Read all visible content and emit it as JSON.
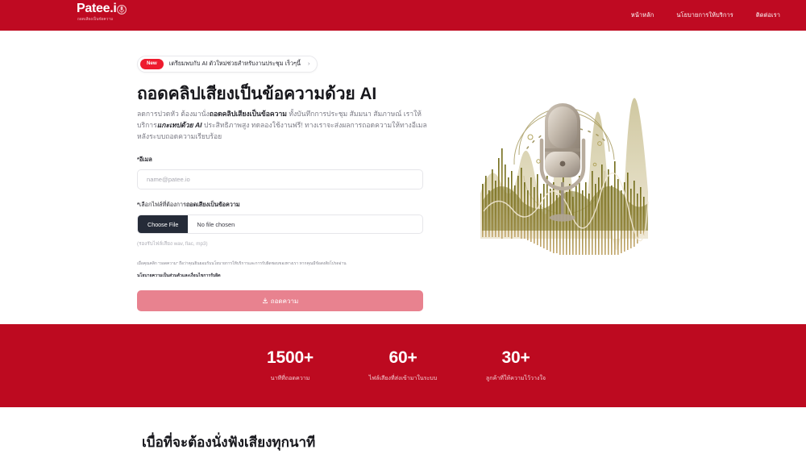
{
  "header": {
    "logo": {
      "text": "Patee.i",
      "mic_icon": "microphone-icon",
      "subtitle": "ถอดเสียงเป็นข้อความ"
    },
    "brand_color": "#bf0a22",
    "nav": [
      {
        "label": "หน้าหลัก",
        "name": "nav-home"
      },
      {
        "label": "นโยบายการให้บริการ",
        "name": "nav-service-policy"
      },
      {
        "label": "ติดต่อเรา",
        "name": "nav-contact"
      }
    ]
  },
  "hero": {
    "pill": {
      "badge": "New",
      "badge_color": "#ee1b2e",
      "text": "เตรียมพบกับ AI ตัวใหม่ช่วยสำหรับงานประชุม เร็วๆนี้",
      "chevron": "›"
    },
    "title": "ถอดคลิปเสียงเป็นข้อความด้วย AI",
    "description": {
      "part1": "ลดการปวดหัว ต้องมานั่ง",
      "bold1": "ถอดคลิปเสียงเป็นข้อความ",
      "part2": " ทั้งบันทึกการประชุม สัมมนา สัมภาษณ์ เราให้บริการ",
      "bold2": "แกะเทปด้วย AI",
      "part3": " ประสิทธิภาพสูง ทดลองใช้งานฟรี! ทางเราจะส่งผลการถอดความให้ทางอีเมลหลังระบบถอดความเรียบร้อย"
    },
    "image_alt": "vintage-microphone-waveform-illustration"
  },
  "form": {
    "email": {
      "label_required": "*",
      "label": "อีเมล",
      "placeholder": "name@patee.io",
      "value": ""
    },
    "file": {
      "label_required": "*",
      "label_plain": "เลือกไฟล์ที่ต้องการ",
      "label_bold": "ถอดเสียงเป็นข้อความ",
      "choose_button": "Choose File",
      "chosen_text": "No file chosen",
      "hint": "(รองรับไฟล์เสียง wav, flac, mp3)"
    },
    "consent": {
      "line1": "เมื่อคุณคลิก \"ถอดความ\" ถือว่าคุณยินยอมรับนโยบายการให้บริการและการรับผิดชอบของทางเรา หากคุณมีข้อสงสัยโปรดอ่าน",
      "line2": "นโยบายความเป็นส่วนตัวและเงื่อนไขการรับผิด"
    },
    "submit": {
      "label": "ถอดความ",
      "icon": "download-icon",
      "color": "#e8828f",
      "disabled": true
    }
  },
  "stats": {
    "background_color": "#bd0a20",
    "items": [
      {
        "value": "1500+",
        "label": "นาทีที่ถอดความ"
      },
      {
        "value": "60+",
        "label": "ไฟล์เสียงที่ส่งเข้ามาในระบบ"
      },
      {
        "value": "30+",
        "label": "ลูกค้าที่ให้ความไว้วางใจ"
      }
    ]
  },
  "bottom": {
    "title": "เบื่อที่จะต้องนั่งฟังเสียงทุกนาที"
  }
}
